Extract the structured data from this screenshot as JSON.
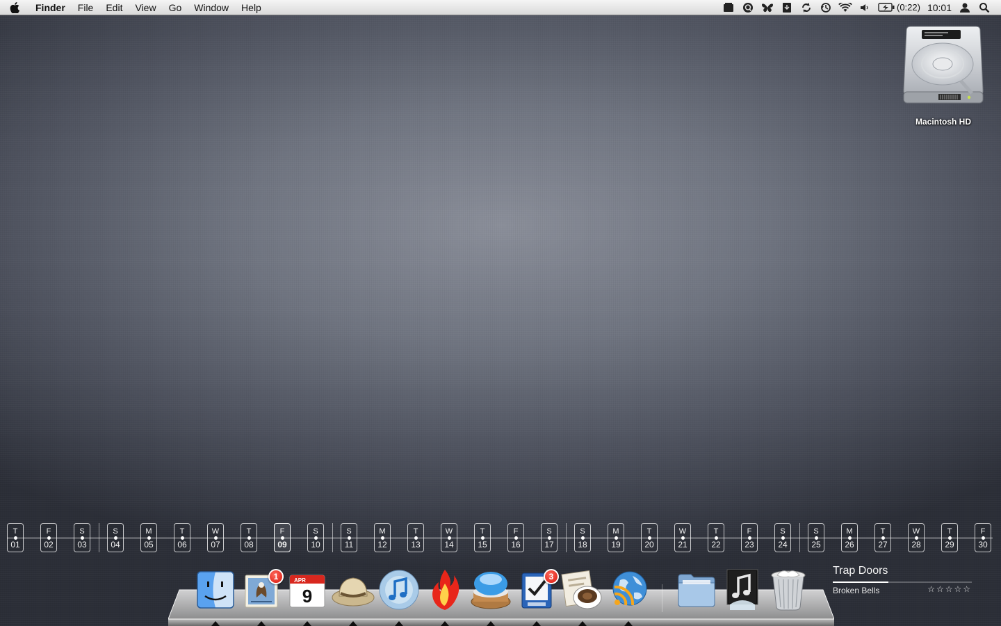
{
  "menubar": {
    "app_name": "Finder",
    "items": [
      "File",
      "Edit",
      "View",
      "Go",
      "Window",
      "Help"
    ],
    "status_icons": [
      "notes-icon",
      "quicksilver-icon",
      "butterfly-icon",
      "download-icon",
      "sync-icon",
      "time-machine-icon",
      "wifi-icon",
      "volume-icon"
    ],
    "battery_time": "(0:22)",
    "clock": "10:01"
  },
  "desktop": {
    "drive_label": "Macintosh HD"
  },
  "calendar": {
    "days": [
      {
        "dow": "T",
        "num": "01"
      },
      {
        "dow": "F",
        "num": "02"
      },
      {
        "dow": "S",
        "num": "03"
      },
      {
        "dow": "S",
        "num": "04"
      },
      {
        "dow": "M",
        "num": "05"
      },
      {
        "dow": "T",
        "num": "06"
      },
      {
        "dow": "W",
        "num": "07"
      },
      {
        "dow": "T",
        "num": "08"
      },
      {
        "dow": "F",
        "num": "09"
      },
      {
        "dow": "S",
        "num": "10"
      },
      {
        "dow": "S",
        "num": "11"
      },
      {
        "dow": "M",
        "num": "12"
      },
      {
        "dow": "T",
        "num": "13"
      },
      {
        "dow": "W",
        "num": "14"
      },
      {
        "dow": "T",
        "num": "15"
      },
      {
        "dow": "F",
        "num": "16"
      },
      {
        "dow": "S",
        "num": "17"
      },
      {
        "dow": "S",
        "num": "18"
      },
      {
        "dow": "M",
        "num": "19"
      },
      {
        "dow": "T",
        "num": "20"
      },
      {
        "dow": "W",
        "num": "21"
      },
      {
        "dow": "T",
        "num": "22"
      },
      {
        "dow": "F",
        "num": "23"
      },
      {
        "dow": "S",
        "num": "24"
      },
      {
        "dow": "S",
        "num": "25"
      },
      {
        "dow": "M",
        "num": "26"
      },
      {
        "dow": "T",
        "num": "27"
      },
      {
        "dow": "W",
        "num": "28"
      },
      {
        "dow": "T",
        "num": "29"
      },
      {
        "dow": "F",
        "num": "30"
      }
    ],
    "today": "09"
  },
  "dock": {
    "apps": [
      {
        "name": "finder-icon",
        "running": true
      },
      {
        "name": "mail-icon",
        "running": true,
        "badge": "1"
      },
      {
        "name": "ical-icon",
        "running": true,
        "month": "APR",
        "day": "9"
      },
      {
        "name": "safari-explorer-hat-icon",
        "running": true
      },
      {
        "name": "itunes-icon",
        "running": true
      },
      {
        "name": "flame-app-icon",
        "running": true
      },
      {
        "name": "button-app-icon",
        "running": true
      },
      {
        "name": "task-list-icon",
        "running": true,
        "badge": "3"
      },
      {
        "name": "coffee-letter-icon",
        "running": true
      },
      {
        "name": "rss-globe-icon",
        "running": true
      },
      {
        "name": "documents-folder-icon",
        "running": false
      },
      {
        "name": "music-stack-icon",
        "running": false
      },
      {
        "name": "trash-icon",
        "running": false
      }
    ]
  },
  "now_playing": {
    "title": "Trap Doors",
    "artist": "Broken Bells",
    "stars": "☆☆☆☆☆",
    "progress": 0.4
  }
}
